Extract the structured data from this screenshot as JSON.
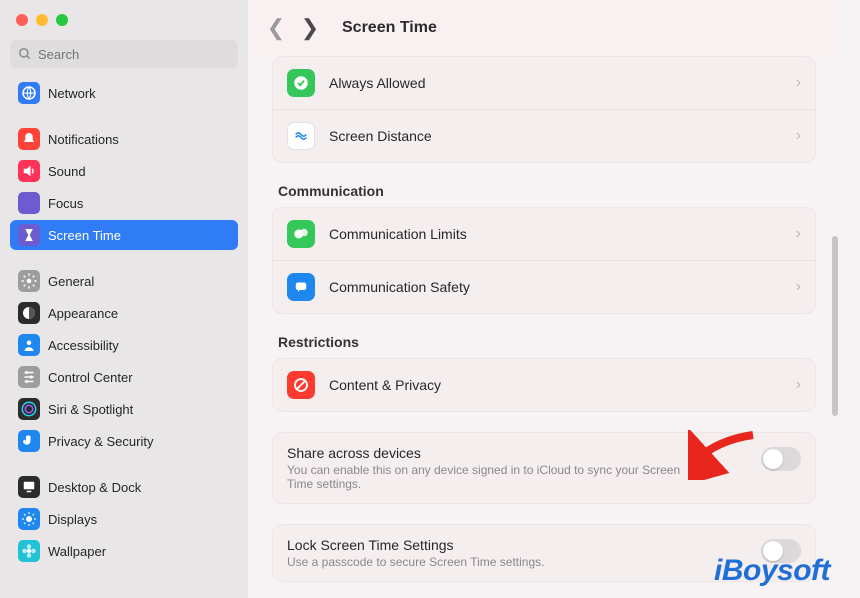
{
  "search": {
    "placeholder": "Search"
  },
  "header": {
    "title": "Screen Time"
  },
  "sidebar": {
    "items": [
      {
        "label": "Network",
        "selected": false,
        "color": "#2f7cf6",
        "icon": "globe"
      },
      {
        "gap": true
      },
      {
        "label": "Notifications",
        "selected": false,
        "color": "#ff4437",
        "icon": "bell"
      },
      {
        "label": "Sound",
        "selected": false,
        "color": "#ff3358",
        "icon": "speaker"
      },
      {
        "label": "Focus",
        "selected": false,
        "color": "#6c5ccf",
        "icon": "moon"
      },
      {
        "label": "Screen Time",
        "selected": true,
        "color": "#6c5ccf",
        "icon": "hourglass"
      },
      {
        "gap": true
      },
      {
        "label": "General",
        "selected": false,
        "color": "#9d9d9d",
        "icon": "gear"
      },
      {
        "label": "Appearance",
        "selected": false,
        "color": "#2c2c2c",
        "icon": "appearance"
      },
      {
        "label": "Accessibility",
        "selected": false,
        "color": "#1e87f0",
        "icon": "person"
      },
      {
        "label": "Control Center",
        "selected": false,
        "color": "#9d9d9d",
        "icon": "sliders"
      },
      {
        "label": "Siri & Spotlight",
        "selected": false,
        "color": "#2c2c2c",
        "icon": "siri"
      },
      {
        "label": "Privacy & Security",
        "selected": false,
        "color": "#1e87f0",
        "icon": "hand"
      },
      {
        "gap": true
      },
      {
        "label": "Desktop & Dock",
        "selected": false,
        "color": "#2c2c2c",
        "icon": "desktop"
      },
      {
        "label": "Displays",
        "selected": false,
        "color": "#1e87f0",
        "icon": "sun"
      },
      {
        "label": "Wallpaper",
        "selected": false,
        "color": "#22c2d6",
        "icon": "flower"
      }
    ]
  },
  "sections": {
    "top": [
      {
        "label": "Always Allowed",
        "color": "#34c759",
        "icon": "check"
      },
      {
        "label": "Screen Distance",
        "color": "#ffffff",
        "icon": "wave",
        "iconColor": "#1e87f0",
        "border": true
      }
    ],
    "communication_title": "Communication",
    "communication": [
      {
        "label": "Communication Limits",
        "color": "#34c759",
        "icon": "bubbles"
      },
      {
        "label": "Communication Safety",
        "color": "#1e87f0",
        "icon": "chat"
      }
    ],
    "restrictions_title": "Restrictions",
    "restrictions": [
      {
        "label": "Content & Privacy",
        "color": "#ff3b30",
        "icon": "nosign"
      }
    ],
    "share": {
      "title": "Share across devices",
      "sub": "You can enable this on any device signed in to iCloud to sync your Screen Time settings."
    },
    "lock": {
      "title": "Lock Screen Time Settings",
      "sub": "Use a passcode to secure Screen Time settings."
    }
  },
  "watermark": "iBoysoft"
}
